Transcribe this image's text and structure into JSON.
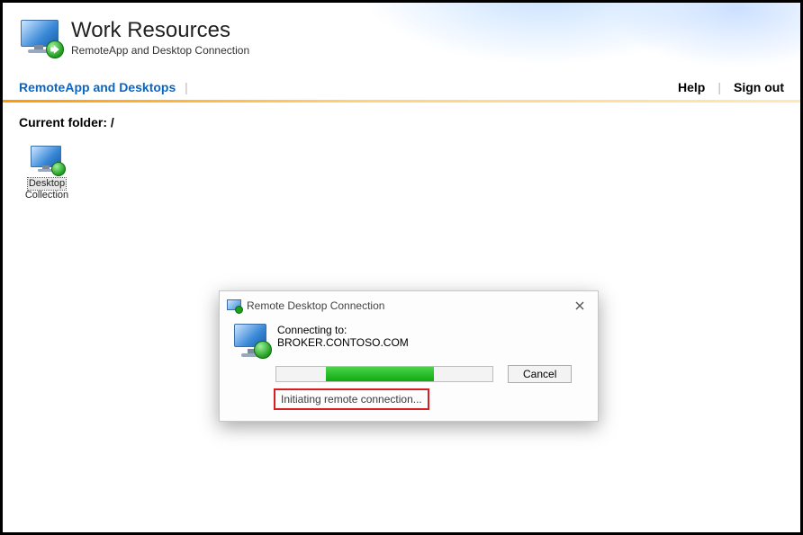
{
  "header": {
    "title": "Work Resources",
    "subtitle": "RemoteApp and Desktop Connection"
  },
  "nav": {
    "tab": "RemoteApp and Desktops",
    "help": "Help",
    "signout": "Sign out"
  },
  "main": {
    "current_folder_label": "Current folder: /",
    "items": [
      {
        "label_line1": "Desktop",
        "label_line2": "Collection"
      }
    ]
  },
  "dialog": {
    "title": "Remote Desktop Connection",
    "connecting_label": "Connecting to:",
    "host": "BROKER.CONTOSO.COM",
    "status": "Initiating remote connection...",
    "cancel": "Cancel"
  }
}
